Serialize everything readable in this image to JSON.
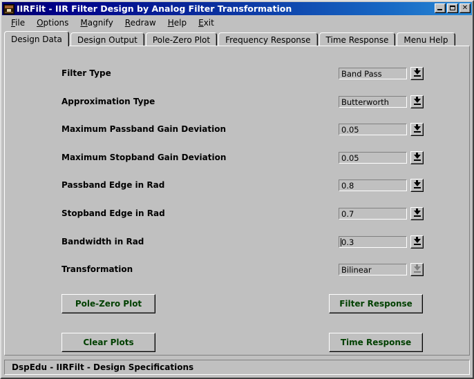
{
  "window": {
    "title": "IIRFilt - IIR Filter Design by Analog Filter Transformation",
    "icon": "app-icon",
    "controls": {
      "minimize_label": "_",
      "maximize_label": "□",
      "close_label": "✕"
    }
  },
  "menubar": {
    "items": [
      {
        "label": "File",
        "accel": "F",
        "rest": "ile"
      },
      {
        "label": "Options",
        "accel": "O",
        "rest": "ptions"
      },
      {
        "label": "Magnify",
        "accel": "M",
        "rest": "agnify"
      },
      {
        "label": "Redraw",
        "accel": "R",
        "rest": "edraw"
      },
      {
        "label": "Help",
        "accel": "H",
        "rest": "elp"
      },
      {
        "label": "Exit",
        "accel": "E",
        "rest": "xit"
      }
    ]
  },
  "tabs": [
    {
      "label": "Design Data",
      "active": true
    },
    {
      "label": "Design Output",
      "active": false
    },
    {
      "label": "Pole-Zero Plot",
      "active": false
    },
    {
      "label": "Frequency Response",
      "active": false
    },
    {
      "label": "Time Response",
      "active": false
    },
    {
      "label": "Menu Help",
      "active": false
    }
  ],
  "form": {
    "rows": [
      {
        "label": "Filter Type",
        "value": "Band Pass",
        "disabled": false,
        "focused": false
      },
      {
        "label": "Approximation Type",
        "value": "Butterworth",
        "disabled": false,
        "focused": false
      },
      {
        "label": "Maximum Passband Gain Deviation",
        "value": "0.05",
        "disabled": false,
        "focused": false
      },
      {
        "label": "Maximum Stopband Gain Deviation",
        "value": "0.05",
        "disabled": false,
        "focused": false
      },
      {
        "label": "Passband Edge in Rad",
        "value": "0.8",
        "disabled": false,
        "focused": false
      },
      {
        "label": "Stopband Edge in Rad",
        "value": "0.7",
        "disabled": false,
        "focused": false
      },
      {
        "label": "Bandwidth in Rad",
        "value": "0.3",
        "disabled": false,
        "focused": true
      },
      {
        "label": "Transformation",
        "value": "Bilinear",
        "disabled": true,
        "focused": false
      }
    ]
  },
  "buttons": {
    "pole_zero_plot": "Pole-Zero Plot",
    "clear_plots": "Clear Plots",
    "filter_response": "Filter Response",
    "time_response": "Time Response"
  },
  "statusbar": {
    "text": "DspEdu - IIRFilt - Design Specifications"
  },
  "colors": {
    "face": "#c0c0c0",
    "title_start": "#00006b",
    "title_end": "#2a8ad6",
    "button_text": "#004000",
    "text": "#000000"
  }
}
